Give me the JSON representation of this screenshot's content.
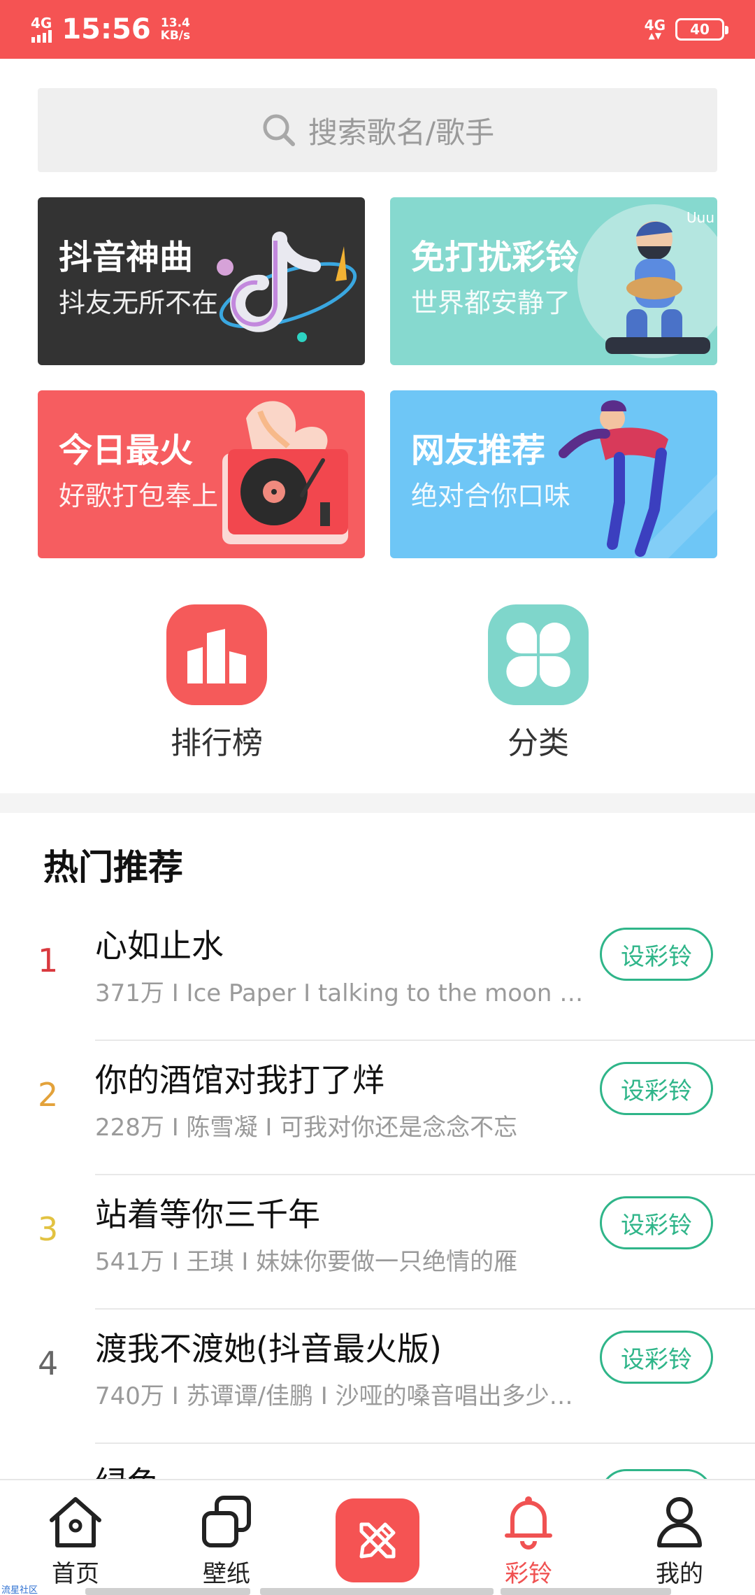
{
  "status_bar": {
    "network": "4G",
    "time": "15:56",
    "speed_value": "13.4",
    "speed_unit": "KB/s",
    "network_right": "4G",
    "battery": "40"
  },
  "search": {
    "placeholder": "搜索歌名/歌手"
  },
  "banners": [
    {
      "title": "抖音神曲",
      "subtitle": "抖友无所不在"
    },
    {
      "title": "免打扰彩铃",
      "subtitle": "世界都安静了"
    },
    {
      "title": "今日最火",
      "subtitle": "好歌打包奉上"
    },
    {
      "title": "网友推荐",
      "subtitle": "绝对合你口味"
    }
  ],
  "quick_links": [
    {
      "label": "排行榜",
      "icon": "chart-icon"
    },
    {
      "label": "分类",
      "icon": "grid-icon"
    }
  ],
  "section": {
    "title": "热门推荐"
  },
  "songs": [
    {
      "rank": "1",
      "title": "心如止水",
      "meta": "371万 I  Ice Paper  I  talking to the moon 放…",
      "button": "设彩铃"
    },
    {
      "rank": "2",
      "title": "你的酒馆对我打了烊",
      "meta": "228万 I  陈雪凝  I  可我对你还是念念不忘",
      "button": "设彩铃"
    },
    {
      "rank": "3",
      "title": "站着等你三千年",
      "meta": "541万 I  王琪  I  妹妹你要做一只绝情的雁",
      "button": "设彩铃"
    },
    {
      "rank": "4",
      "title": "渡我不渡她(抖音最火版)",
      "meta": "740万 I  苏谭谭/佳鹏  I  沙哑的嗓音唱出多少…",
      "button": "设彩铃"
    },
    {
      "rank": "",
      "title": "绿色",
      "meta": "",
      "button": ""
    }
  ],
  "bottom_nav": [
    {
      "label": "首页",
      "icon": "home-icon"
    },
    {
      "label": "壁纸",
      "icon": "wallpaper-icon"
    },
    {
      "label": "",
      "icon": "pencil-ruler-icon"
    },
    {
      "label": "彩铃",
      "icon": "bell-icon"
    },
    {
      "label": "我的",
      "icon": "person-icon"
    }
  ],
  "watermark": "流星社区",
  "colors": {
    "accent": "#f55353",
    "green": "#2fb589",
    "rank1": "#d9393e",
    "rank2": "#e3a23a",
    "rank3": "#e2c241"
  }
}
